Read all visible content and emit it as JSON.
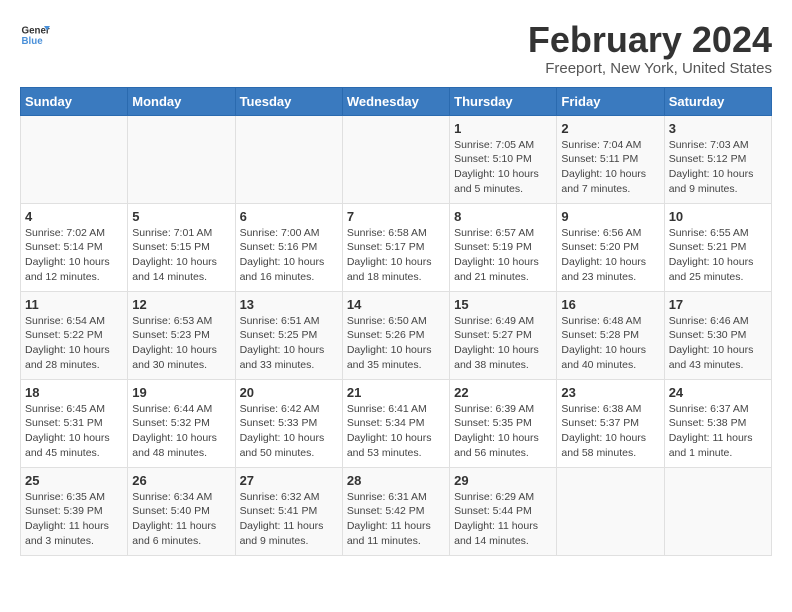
{
  "header": {
    "logo_line1": "General",
    "logo_line2": "Blue",
    "title": "February 2024",
    "subtitle": "Freeport, New York, United States"
  },
  "calendar": {
    "weekdays": [
      "Sunday",
      "Monday",
      "Tuesday",
      "Wednesday",
      "Thursday",
      "Friday",
      "Saturday"
    ],
    "weeks": [
      [
        {
          "day": "",
          "info": ""
        },
        {
          "day": "",
          "info": ""
        },
        {
          "day": "",
          "info": ""
        },
        {
          "day": "",
          "info": ""
        },
        {
          "day": "1",
          "info": "Sunrise: 7:05 AM\nSunset: 5:10 PM\nDaylight: 10 hours\nand 5 minutes."
        },
        {
          "day": "2",
          "info": "Sunrise: 7:04 AM\nSunset: 5:11 PM\nDaylight: 10 hours\nand 7 minutes."
        },
        {
          "day": "3",
          "info": "Sunrise: 7:03 AM\nSunset: 5:12 PM\nDaylight: 10 hours\nand 9 minutes."
        }
      ],
      [
        {
          "day": "4",
          "info": "Sunrise: 7:02 AM\nSunset: 5:14 PM\nDaylight: 10 hours\nand 12 minutes."
        },
        {
          "day": "5",
          "info": "Sunrise: 7:01 AM\nSunset: 5:15 PM\nDaylight: 10 hours\nand 14 minutes."
        },
        {
          "day": "6",
          "info": "Sunrise: 7:00 AM\nSunset: 5:16 PM\nDaylight: 10 hours\nand 16 minutes."
        },
        {
          "day": "7",
          "info": "Sunrise: 6:58 AM\nSunset: 5:17 PM\nDaylight: 10 hours\nand 18 minutes."
        },
        {
          "day": "8",
          "info": "Sunrise: 6:57 AM\nSunset: 5:19 PM\nDaylight: 10 hours\nand 21 minutes."
        },
        {
          "day": "9",
          "info": "Sunrise: 6:56 AM\nSunset: 5:20 PM\nDaylight: 10 hours\nand 23 minutes."
        },
        {
          "day": "10",
          "info": "Sunrise: 6:55 AM\nSunset: 5:21 PM\nDaylight: 10 hours\nand 25 minutes."
        }
      ],
      [
        {
          "day": "11",
          "info": "Sunrise: 6:54 AM\nSunset: 5:22 PM\nDaylight: 10 hours\nand 28 minutes."
        },
        {
          "day": "12",
          "info": "Sunrise: 6:53 AM\nSunset: 5:23 PM\nDaylight: 10 hours\nand 30 minutes."
        },
        {
          "day": "13",
          "info": "Sunrise: 6:51 AM\nSunset: 5:25 PM\nDaylight: 10 hours\nand 33 minutes."
        },
        {
          "day": "14",
          "info": "Sunrise: 6:50 AM\nSunset: 5:26 PM\nDaylight: 10 hours\nand 35 minutes."
        },
        {
          "day": "15",
          "info": "Sunrise: 6:49 AM\nSunset: 5:27 PM\nDaylight: 10 hours\nand 38 minutes."
        },
        {
          "day": "16",
          "info": "Sunrise: 6:48 AM\nSunset: 5:28 PM\nDaylight: 10 hours\nand 40 minutes."
        },
        {
          "day": "17",
          "info": "Sunrise: 6:46 AM\nSunset: 5:30 PM\nDaylight: 10 hours\nand 43 minutes."
        }
      ],
      [
        {
          "day": "18",
          "info": "Sunrise: 6:45 AM\nSunset: 5:31 PM\nDaylight: 10 hours\nand 45 minutes."
        },
        {
          "day": "19",
          "info": "Sunrise: 6:44 AM\nSunset: 5:32 PM\nDaylight: 10 hours\nand 48 minutes."
        },
        {
          "day": "20",
          "info": "Sunrise: 6:42 AM\nSunset: 5:33 PM\nDaylight: 10 hours\nand 50 minutes."
        },
        {
          "day": "21",
          "info": "Sunrise: 6:41 AM\nSunset: 5:34 PM\nDaylight: 10 hours\nand 53 minutes."
        },
        {
          "day": "22",
          "info": "Sunrise: 6:39 AM\nSunset: 5:35 PM\nDaylight: 10 hours\nand 56 minutes."
        },
        {
          "day": "23",
          "info": "Sunrise: 6:38 AM\nSunset: 5:37 PM\nDaylight: 10 hours\nand 58 minutes."
        },
        {
          "day": "24",
          "info": "Sunrise: 6:37 AM\nSunset: 5:38 PM\nDaylight: 11 hours\nand 1 minute."
        }
      ],
      [
        {
          "day": "25",
          "info": "Sunrise: 6:35 AM\nSunset: 5:39 PM\nDaylight: 11 hours\nand 3 minutes."
        },
        {
          "day": "26",
          "info": "Sunrise: 6:34 AM\nSunset: 5:40 PM\nDaylight: 11 hours\nand 6 minutes."
        },
        {
          "day": "27",
          "info": "Sunrise: 6:32 AM\nSunset: 5:41 PM\nDaylight: 11 hours\nand 9 minutes."
        },
        {
          "day": "28",
          "info": "Sunrise: 6:31 AM\nSunset: 5:42 PM\nDaylight: 11 hours\nand 11 minutes."
        },
        {
          "day": "29",
          "info": "Sunrise: 6:29 AM\nSunset: 5:44 PM\nDaylight: 11 hours\nand 14 minutes."
        },
        {
          "day": "",
          "info": ""
        },
        {
          "day": "",
          "info": ""
        }
      ]
    ]
  }
}
